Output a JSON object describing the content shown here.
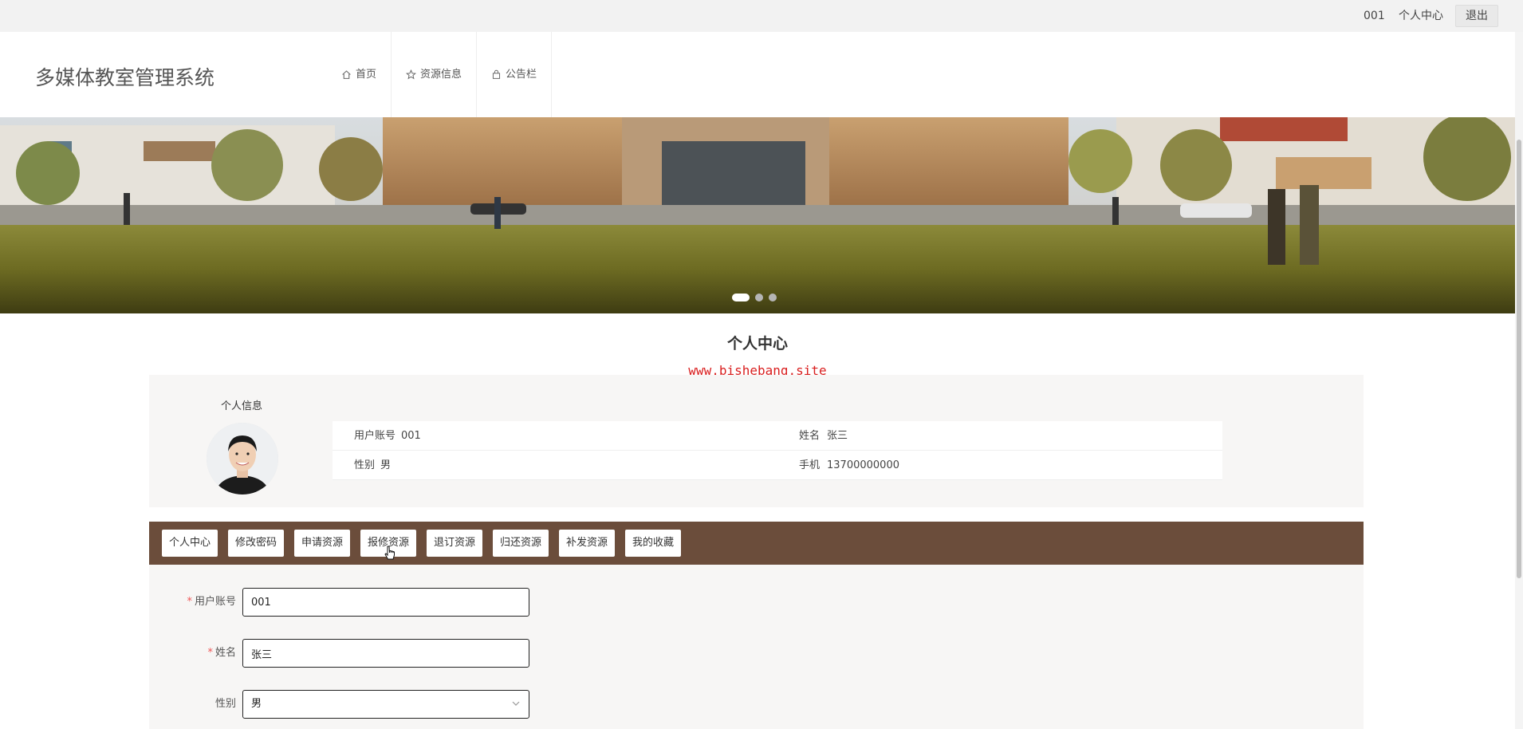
{
  "topbar": {
    "username": "001",
    "profile_link": "个人中心",
    "logout_label": "退出"
  },
  "header": {
    "site_title": "多媒体教室管理系统",
    "nav": [
      {
        "label": "首页",
        "icon": "home-icon"
      },
      {
        "label": "资源信息",
        "icon": "star-icon"
      },
      {
        "label": "公告栏",
        "icon": "bag-icon"
      }
    ]
  },
  "banner": {
    "slide_count": 3,
    "active_slide": 1
  },
  "page": {
    "heading": "个人中心",
    "watermark": "www.bishebang.site"
  },
  "profile": {
    "section_label": "个人信息",
    "account_label": "用户账号",
    "account_value": "001",
    "name_label": "姓名",
    "name_value": "张三",
    "gender_label": "性别",
    "gender_value": "男",
    "phone_label": "手机",
    "phone_value": "13700000000"
  },
  "tabs": [
    "个人中心",
    "修改密码",
    "申请资源",
    "报修资源",
    "退订资源",
    "归还资源",
    "补发资源",
    "我的收藏"
  ],
  "form": {
    "account_label": "用户账号",
    "account_value": "001",
    "name_label": "姓名",
    "name_value": "张三",
    "gender_label": "性别",
    "gender_value": "男",
    "required_mark": "*"
  },
  "colors": {
    "tabbar_bg": "#6b4d3b",
    "watermark": "#d91e1e",
    "required": "#e55555"
  }
}
